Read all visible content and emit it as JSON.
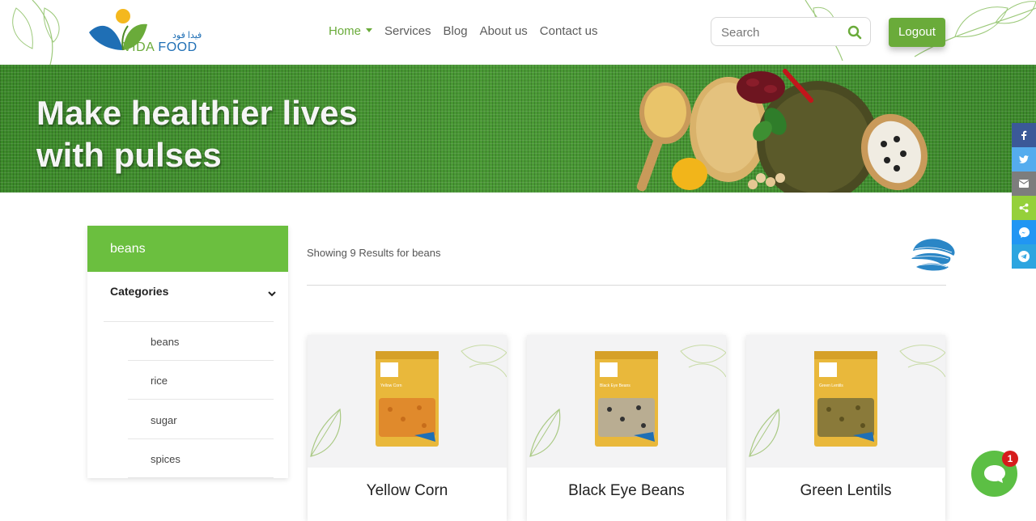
{
  "colors": {
    "brand_green": "#6aab3a",
    "brand_blue": "#1f6fb5",
    "sidebar_green": "#6bbf3f"
  },
  "logo": {
    "arabic": "فيدا فود",
    "word_vida": "VIDA",
    "word_food": "FOOD"
  },
  "nav": [
    {
      "label": "Home",
      "active": true,
      "has_dropdown": true
    },
    {
      "label": "Services"
    },
    {
      "label": "Blog"
    },
    {
      "label": "About us"
    },
    {
      "label": "Contact us"
    }
  ],
  "search": {
    "placeholder": "Search",
    "icon": "search-icon"
  },
  "logout_label": "Logout",
  "hero": {
    "title": "Make healthier lives\nwith pulses"
  },
  "share": [
    {
      "icon": "facebook-icon",
      "color": "#3b5998"
    },
    {
      "icon": "twitter-icon",
      "color": "#55acee"
    },
    {
      "icon": "email-icon",
      "color": "#7d7d7d"
    },
    {
      "icon": "share-icon",
      "color": "#95d03a"
    },
    {
      "icon": "messenger-icon",
      "color": "#2196f3"
    },
    {
      "icon": "telegram-icon",
      "color": "#2ca5e0"
    }
  ],
  "sidebar": {
    "header": "beans",
    "categories_label": "Categories",
    "items": [
      "beans",
      "rice",
      "sugar",
      "spices"
    ]
  },
  "results": {
    "text": "Showing 9 Results for beans"
  },
  "products": [
    {
      "title": "Yellow Corn",
      "pack_label": "Yellow Corn",
      "seed_color": "#e08a2c"
    },
    {
      "title": "Black Eye Beans",
      "pack_label": "Black Eye Beans",
      "seed_color": "#b9ad92"
    },
    {
      "title": "Green Lentils",
      "pack_label": "Green Lentils",
      "seed_color": "#8a7a3a"
    }
  ],
  "chat": {
    "badge_count": "1"
  }
}
